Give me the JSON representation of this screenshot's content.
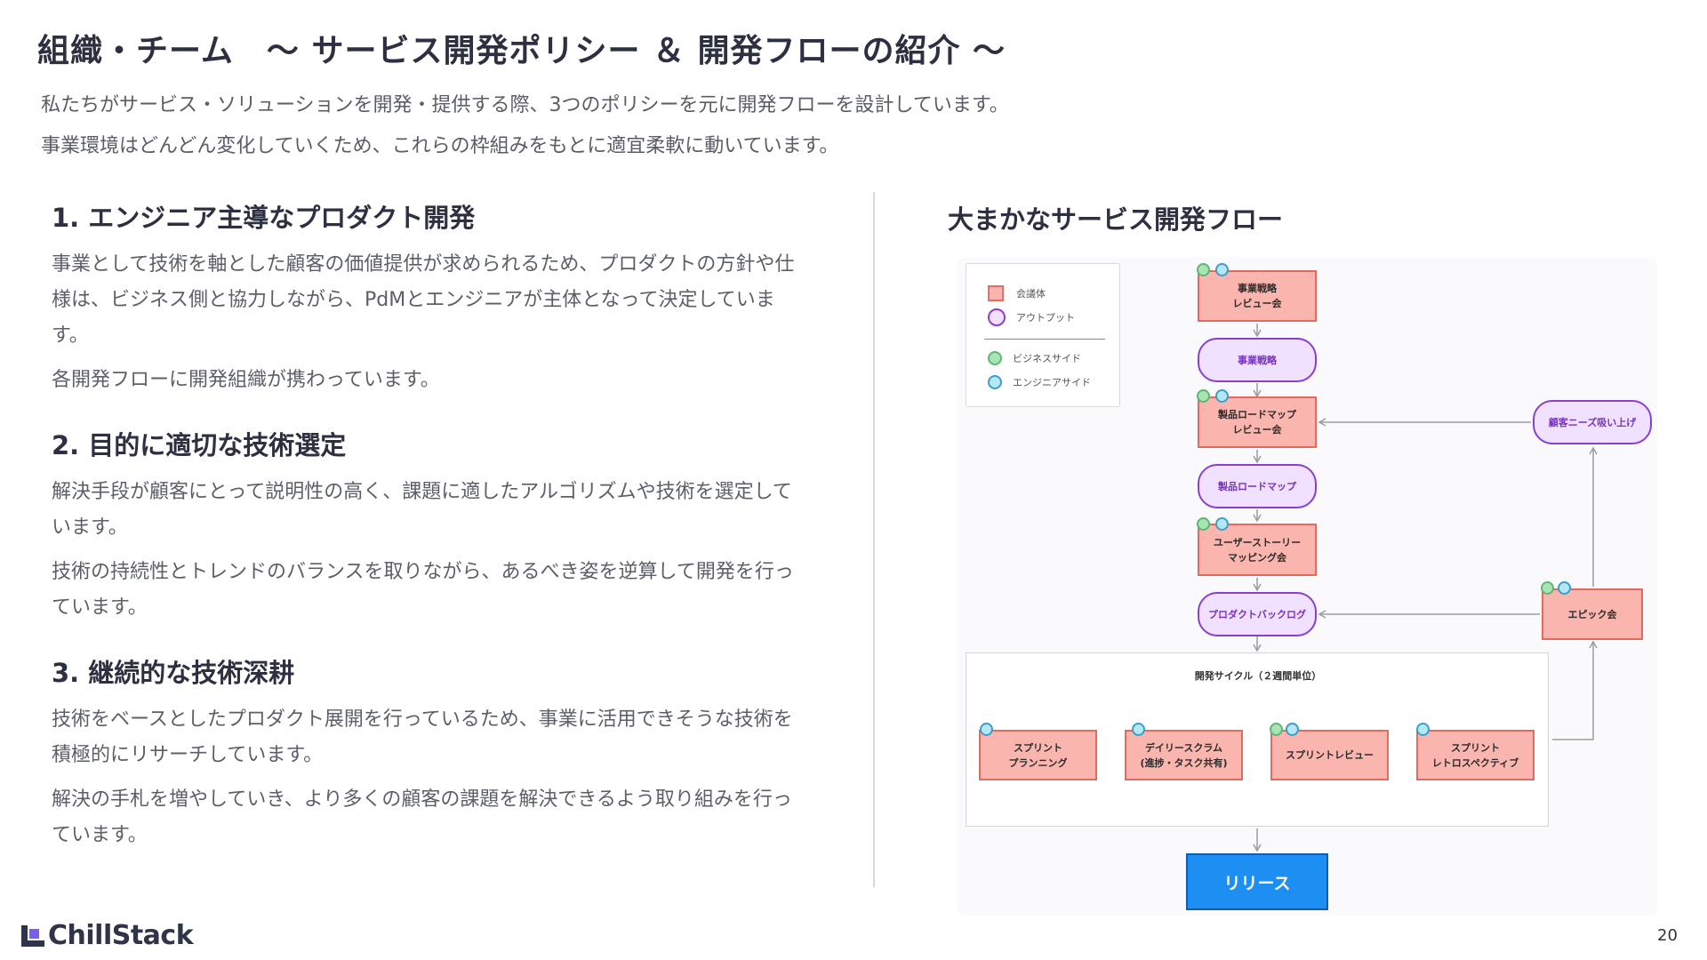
{
  "header": {
    "title": "組織・チーム　〜 サービス開発ポリシー ＆ 開発フローの紹介 〜",
    "intro_line1": "私たちがサービス・ソリューションを開発・提供する際、3つのポリシーを元に開発フローを設計しています。",
    "intro_line2": "事業環境はどんどん変化していくため、これらの枠組みをもとに適宜柔軟に動いています。"
  },
  "policies": [
    {
      "heading": "1. エンジニア主導なプロダクト開発",
      "p1": "事業として技術を軸とした顧客の価値提供が求められるため、プロダクトの方針や仕様は、ビジネス側と協力しながら、PdMとエンジニアが主体となって決定しています。",
      "p2": "各開発フローに開発組織が携わっています。"
    },
    {
      "heading": "2. 目的に適切な技術選定",
      "p1": "解決手段が顧客にとって説明性の高く、課題に適したアルゴリズムや技術を選定しています。",
      "p2": "技術の持続性とトレンドのバランスを取りながら、あるべき姿を逆算して開発を行っています。"
    },
    {
      "heading": "3. 継続的な技術深耕",
      "p1": "技術をベースとしたプロダクト展開を行っているため、事業に活用できそうな技術を積極的にリサーチしています。",
      "p2": "解決の手札を増やしていき、より多くの顧客の課題を解決できるよう取り組みを行っています。"
    }
  ],
  "flow": {
    "title": "大まかなサービス開発フロー",
    "legend": {
      "meeting": "会議体",
      "output": "アウトプット",
      "business": "ビジネスサイド",
      "engineer": "エンジニアサイド"
    },
    "colors": {
      "meeting_fill": "#f9b5ae",
      "meeting_border": "#e46a5e",
      "output_fill": "#efe1ff",
      "output_border": "#8a3fd1",
      "business": "#a8e4b4",
      "engineer": "#b5e7f4",
      "release": "#1d8ff2"
    },
    "nodes": {
      "strategy_review": "事業戦略\nレビュー会",
      "strategy": "事業戦略",
      "roadmap_review": "製品ロードマップ\nレビュー会",
      "roadmap": "製品ロードマップ",
      "story_mapping": "ユーザーストーリー\nマッピング会",
      "backlog": "プロダクトバックログ",
      "customer_needs": "顧客ニーズ吸い上げ",
      "epic": "エピック会"
    },
    "cycle": {
      "label": "開発サイクル（２週間単位）",
      "planning": "スプリント\nプランニング",
      "daily": "デイリースクラム\n(進捗・タスク共有)",
      "review": "スプリントレビュー",
      "retro": "スプリント\nレトロスペクティブ"
    },
    "release": "リリース"
  },
  "footer": {
    "brand": "ChillStack",
    "page": "20"
  }
}
